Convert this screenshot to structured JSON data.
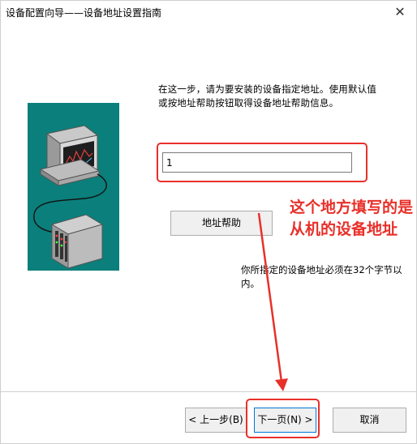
{
  "window": {
    "title": "设备配置向导——设备地址设置指南",
    "close_glyph": "✕"
  },
  "illustration": {
    "background": "#0b7f7b",
    "content": "computer-connected-to-device-icon"
  },
  "instruction": {
    "text": "在这一步，请为要安装的设备指定地址。使用默认值或按地址帮助按钮取得设备地址帮助信息。"
  },
  "address_input": {
    "value": "1"
  },
  "help_button": {
    "label": "地址帮助"
  },
  "annotation": {
    "text": "这个地方填写的是从机的设备地址",
    "color": "#e8302a"
  },
  "note": {
    "text": "你所指定的设备地址必须在32个字节以内。"
  },
  "buttons": {
    "back": "< 上一步(B)",
    "next": "下一页(N) >",
    "cancel": "取消"
  }
}
